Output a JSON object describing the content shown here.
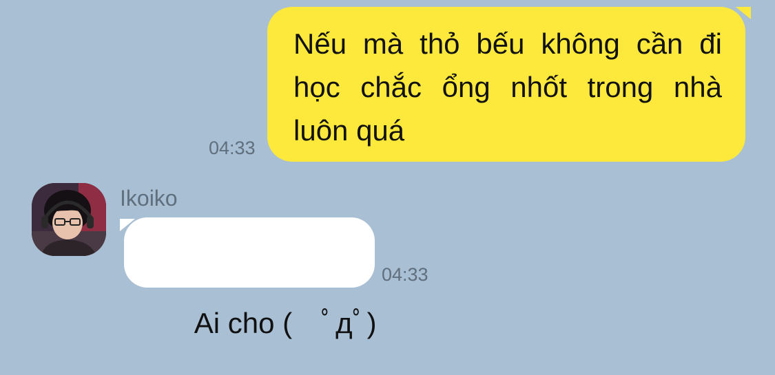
{
  "messages": {
    "outgoing": {
      "text": " Nếu mà thỏ bếu không cần đi học chắc ổng nhốt trong nhà luôn quá",
      "time": "04:33"
    },
    "incoming": {
      "sender": "Ikoiko",
      "text": "Ai cho (　ﾟдﾟ)",
      "time": "04:33",
      "avatar_icon": "user-avatar-photo"
    }
  },
  "colors": {
    "background": "#a9bfd3",
    "outgoing_bubble": "#fde93c",
    "incoming_bubble": "#ffffff",
    "timestamp": "#5f6f7d"
  }
}
